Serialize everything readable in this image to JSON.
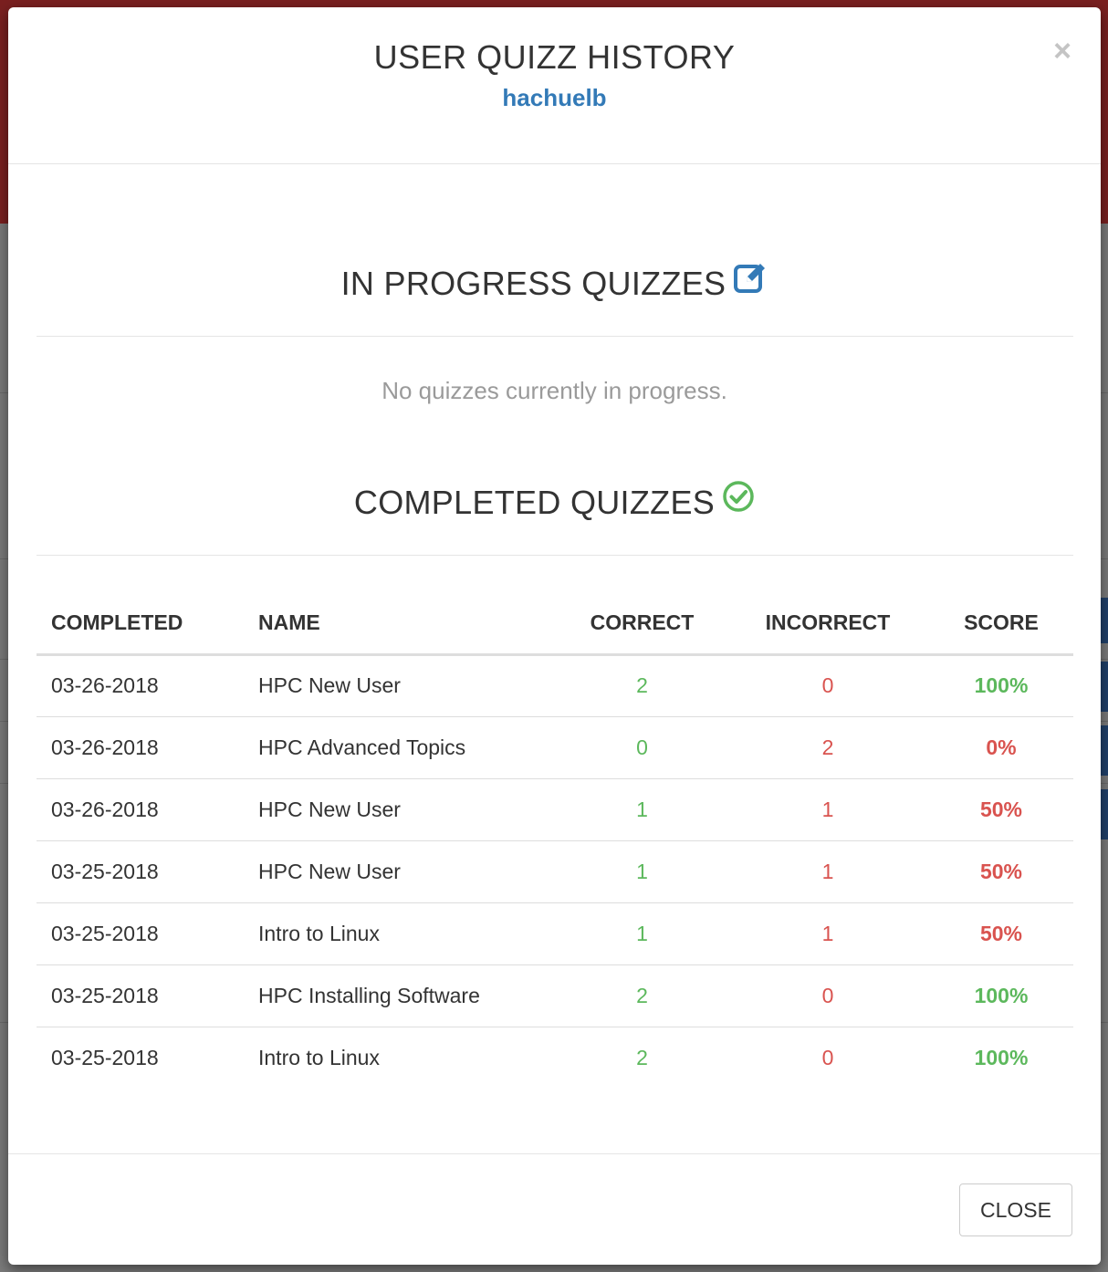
{
  "modal": {
    "title": "USER QUIZZ HISTORY",
    "username": "hachuelb",
    "close_icon": "×"
  },
  "in_progress": {
    "title": "IN PROGRESS QUIZZES",
    "icon": "edit-icon",
    "empty_message": "No quizzes currently in progress."
  },
  "completed": {
    "title": "COMPLETED QUIZZES",
    "icon": "check-circle-icon",
    "columns": [
      "COMPLETED",
      "NAME",
      "CORRECT",
      "INCORRECT",
      "SCORE"
    ],
    "rows": [
      {
        "completed": "03-26-2018",
        "name": "HPC New User",
        "correct": "2",
        "incorrect": "0",
        "score": "100%",
        "score_status": "pass"
      },
      {
        "completed": "03-26-2018",
        "name": "HPC Advanced Topics",
        "correct": "0",
        "incorrect": "2",
        "score": "0%",
        "score_status": "fail"
      },
      {
        "completed": "03-26-2018",
        "name": "HPC New User",
        "correct": "1",
        "incorrect": "1",
        "score": "50%",
        "score_status": "fail"
      },
      {
        "completed": "03-25-2018",
        "name": "HPC New User",
        "correct": "1",
        "incorrect": "1",
        "score": "50%",
        "score_status": "fail"
      },
      {
        "completed": "03-25-2018",
        "name": "Intro to Linux",
        "correct": "1",
        "incorrect": "1",
        "score": "50%",
        "score_status": "fail"
      },
      {
        "completed": "03-25-2018",
        "name": "HPC Installing Software",
        "correct": "2",
        "incorrect": "0",
        "score": "100%",
        "score_status": "pass"
      },
      {
        "completed": "03-25-2018",
        "name": "Intro to Linux",
        "correct": "2",
        "incorrect": "0",
        "score": "100%",
        "score_status": "pass"
      }
    ]
  },
  "footer": {
    "close_label": "CLOSE"
  },
  "colors": {
    "accent": "#337ab7",
    "success": "#5cb85c",
    "danger": "#d9534f"
  }
}
